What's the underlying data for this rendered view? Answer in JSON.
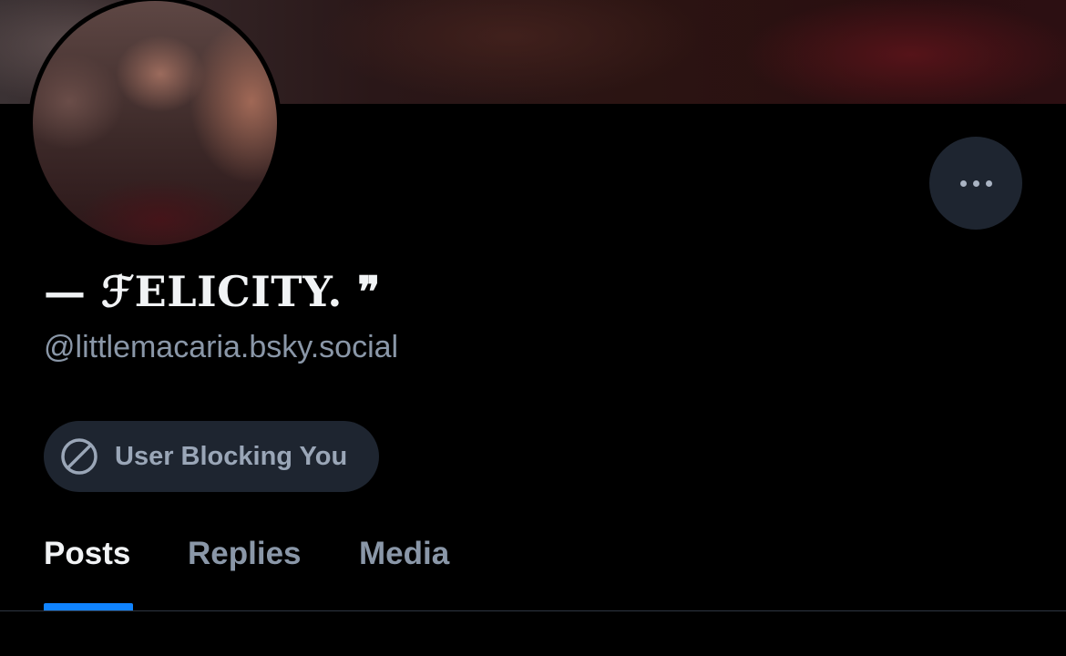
{
  "profile": {
    "display_name": "— ℱELICITY. ❞",
    "handle": "@littlemacaria.bsky.social",
    "blocking_status": "User Blocking You"
  },
  "tabs": [
    {
      "label": "Posts",
      "active": true
    },
    {
      "label": "Replies",
      "active": false
    },
    {
      "label": "Media",
      "active": false
    }
  ],
  "icons": {
    "more_button": "ellipsis-icon",
    "blocking": "block-icon"
  },
  "colors": {
    "background": "#000000",
    "accent": "#1083fe",
    "pill_background": "#1e2530",
    "muted_text": "#8a97a8",
    "primary_text": "#f1f3f5"
  }
}
